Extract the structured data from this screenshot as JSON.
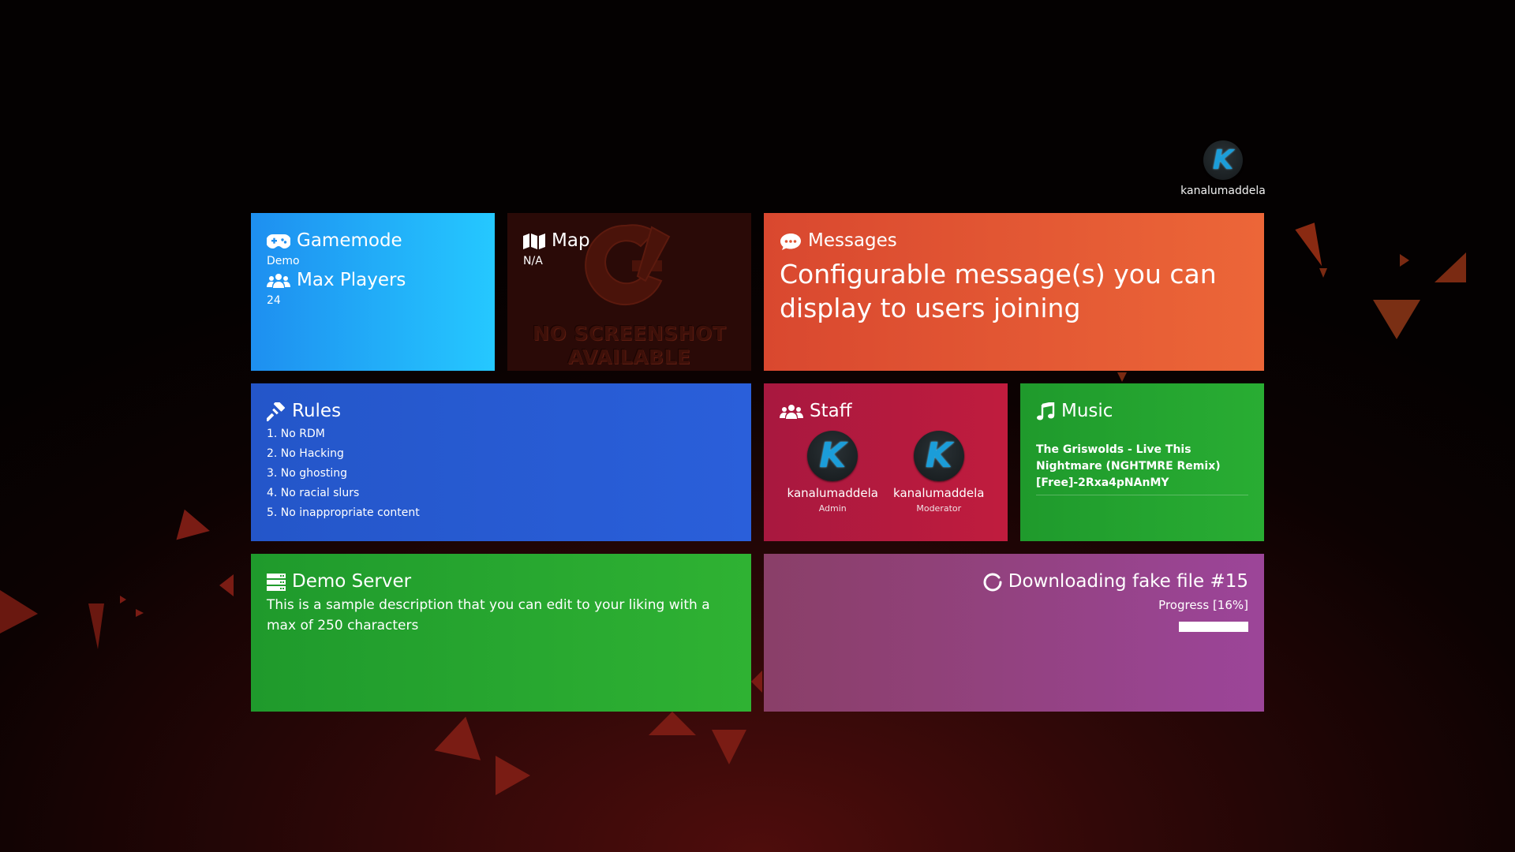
{
  "user": {
    "name": "kanalumaddela",
    "avatar_letter": "K"
  },
  "gamemode": {
    "title": "Gamemode",
    "value": "Demo",
    "players_title": "Max Players",
    "players_value": "24",
    "icon": "gamepad-icon",
    "players_icon": "users-icon"
  },
  "map": {
    "title": "Map",
    "value": "N/A",
    "icon": "map-icon",
    "placeholder_line1": "NO SCREENSHOT",
    "placeholder_line2": "AVAILABLE"
  },
  "messages": {
    "title": "Messages",
    "icon": "comments-icon",
    "text": "Configurable message(s) you can display to users joining"
  },
  "rules": {
    "title": "Rules",
    "icon": "gavel-icon",
    "items": [
      "1. No RDM",
      "2. No Hacking",
      "3. No ghosting",
      "4. No racial slurs",
      "5. No inappropriate content"
    ]
  },
  "staff": {
    "title": "Staff",
    "icon": "users-icon",
    "members": [
      {
        "name": "kanalumaddela",
        "role": "Admin",
        "avatar_letter": "K"
      },
      {
        "name": "kanalumaddela",
        "role": "Moderator",
        "avatar_letter": "K"
      }
    ]
  },
  "music": {
    "title": "Music",
    "icon": "music-icon",
    "song": "The Griswolds - Live This Nightmare (NGHTMRE Remix) [Free]-2Rxa4pNAnMY"
  },
  "server": {
    "title": "Demo Server",
    "icon": "server-icon",
    "description": "This is a sample description that you can edit to your liking with a max of 250 characters"
  },
  "download": {
    "title": "Downloading fake file #15",
    "icon": "spinner-icon",
    "progress_label": "Progress [16%]",
    "progress": 0.16
  },
  "colors": {
    "gamemode": "#25c8ff",
    "messages": "#ec6638",
    "rules": "#2a5fda",
    "staff": "#c01c3e",
    "music": "#29ad33",
    "download": "#9c4599"
  }
}
